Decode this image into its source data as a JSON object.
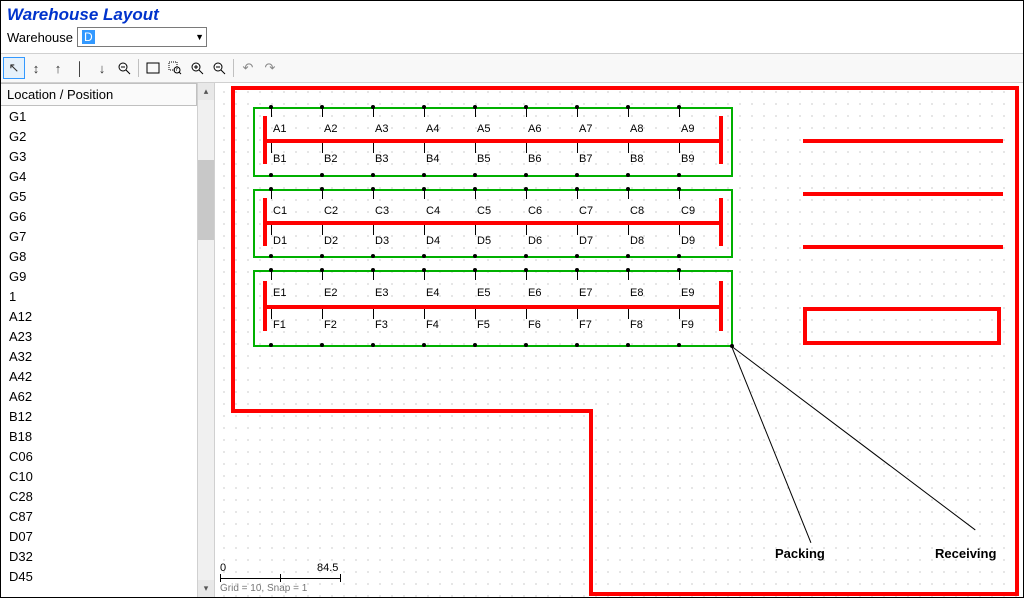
{
  "title": "Warehouse Layout",
  "warehouse_label": "Warehouse",
  "warehouse_value": "D",
  "toolbar": {
    "pointer": "↖",
    "move_v": "↕",
    "move_up": "↑",
    "line_v": "│",
    "move_down": "↓",
    "zoom_out": "⊖",
    "fit": "▭",
    "zoom_region": "⧈",
    "zoom_in": "⊕",
    "zoom_out2": "⊖",
    "undo": "↶",
    "redo": "↷"
  },
  "location_header": "Location / Position",
  "locations": [
    "G1",
    "G2",
    "G3",
    "G4",
    "G5",
    "G6",
    "G7",
    "G8",
    "G9",
    "1",
    "A12",
    "A23",
    "A32",
    "A42",
    "A62",
    "B12",
    "B18",
    "C06",
    "C10",
    "C28",
    "C87",
    "D07",
    "D32",
    "D45"
  ],
  "racks": {
    "A": [
      "A1",
      "A2",
      "A3",
      "A4",
      "A5",
      "A6",
      "A7",
      "A8",
      "A9"
    ],
    "B": [
      "B1",
      "B2",
      "B3",
      "B4",
      "B5",
      "B6",
      "B7",
      "B8",
      "B9"
    ],
    "C": [
      "C1",
      "C2",
      "C3",
      "C4",
      "C5",
      "C6",
      "C7",
      "C8",
      "C9"
    ],
    "D": [
      "D1",
      "D2",
      "D3",
      "D4",
      "D5",
      "D6",
      "D7",
      "D8",
      "D9"
    ],
    "E": [
      "E1",
      "E2",
      "E3",
      "E4",
      "E5",
      "E6",
      "E7",
      "E8",
      "E9"
    ],
    "F": [
      "F1",
      "F2",
      "F3",
      "F4",
      "F5",
      "F6",
      "F7",
      "F8",
      "F9"
    ]
  },
  "zones": {
    "packing": "Packing",
    "receiving": "Receiving"
  },
  "scale": {
    "start": "0",
    "end": "84.5"
  },
  "footer": "Grid = 10, Snap = 1"
}
